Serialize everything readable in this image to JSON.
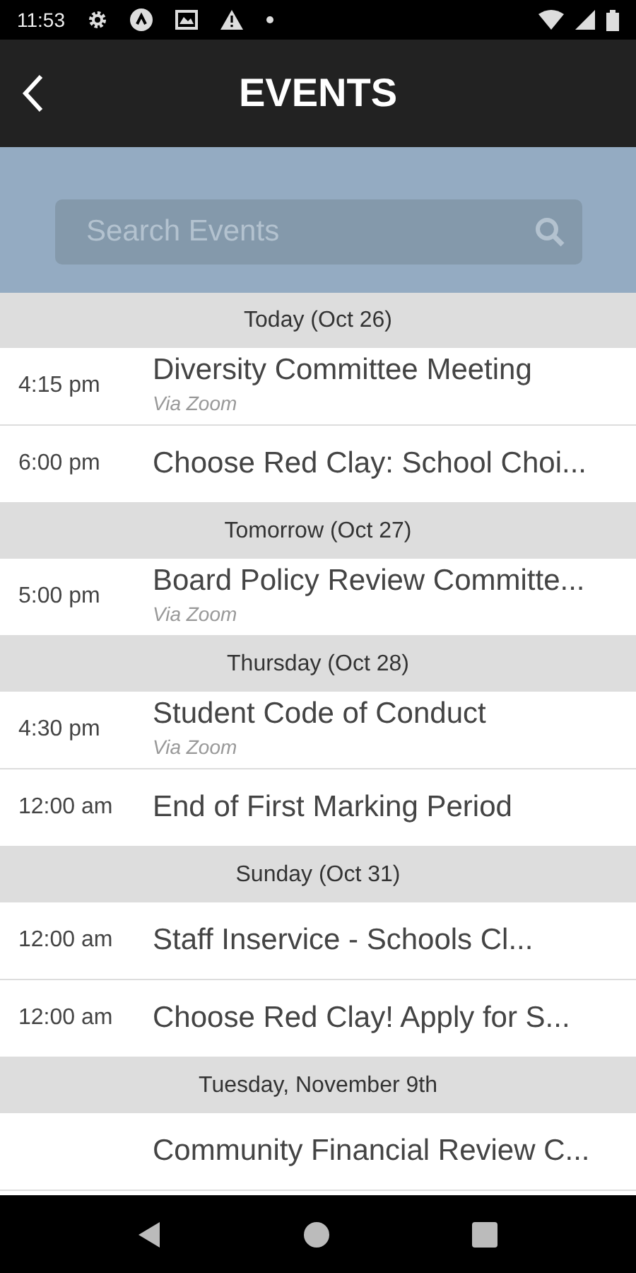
{
  "status_bar": {
    "time": "11:53"
  },
  "header": {
    "title": "EVENTS"
  },
  "search": {
    "placeholder": "Search Events"
  },
  "sections": [
    {
      "heading": "Today (Oct 26)",
      "events": [
        {
          "time": "4:15 pm",
          "title": "Diversity Committee Meeting",
          "location": "Via Zoom"
        },
        {
          "time": "6:00 pm",
          "title": "Choose Red Clay: School Choi..."
        }
      ]
    },
    {
      "heading": "Tomorrow (Oct 27)",
      "events": [
        {
          "time": "5:00 pm",
          "title": "Board Policy Review Committe...",
          "location": "Via Zoom"
        }
      ]
    },
    {
      "heading": "Thursday (Oct 28)",
      "events": [
        {
          "time": "4:30 pm",
          "title": "Student Code of Conduct",
          "location": "Via Zoom"
        },
        {
          "time": "12:00 am",
          "title": "End of First Marking Period"
        }
      ]
    },
    {
      "heading": "Sunday (Oct 31)",
      "events": [
        {
          "time": "12:00 am",
          "title": "Staff Inservice - Schools Cl..."
        },
        {
          "time": "12:00 am",
          "title": "Choose Red Clay! Apply for S..."
        }
      ]
    },
    {
      "heading": "Tuesday, November 9th",
      "events": [
        {
          "title": "Community Financial Review C..."
        }
      ]
    }
  ]
}
